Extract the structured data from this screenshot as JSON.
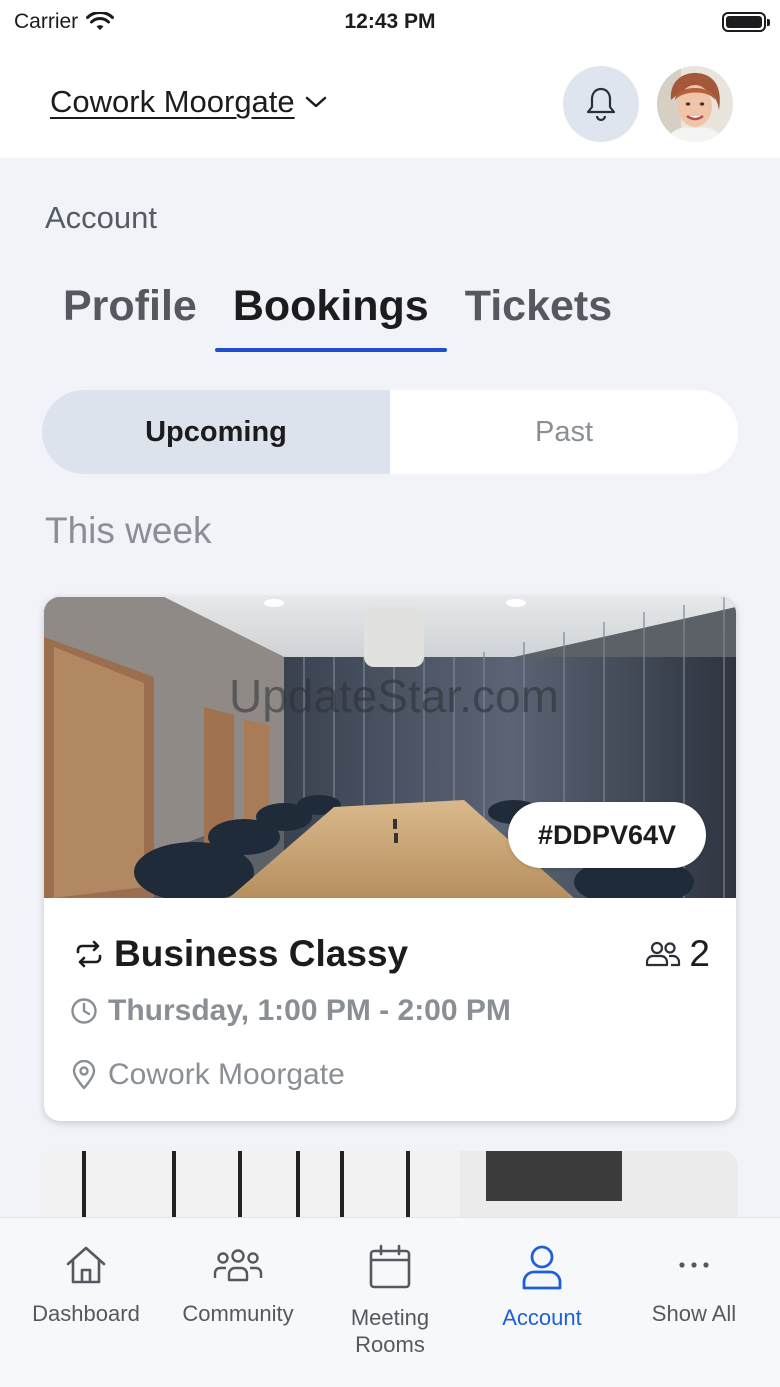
{
  "status_bar": {
    "carrier": "Carrier",
    "time": "12:43 PM"
  },
  "header": {
    "location": "Cowork Moorgate"
  },
  "account": {
    "title": "Account",
    "tabs": [
      {
        "label": "Profile",
        "active": false
      },
      {
        "label": "Bookings",
        "active": true
      },
      {
        "label": "Tickets",
        "active": false
      }
    ],
    "segments": {
      "upcoming": "Upcoming",
      "past": "Past"
    },
    "section_label": "This week"
  },
  "booking": {
    "code": "#DDPV64V",
    "room": "Business Classy",
    "capacity": "2",
    "time": "Thursday, 1:00 PM - 2:00 PM",
    "location": "Cowork Moorgate",
    "watermark": "UpdateStar.com"
  },
  "tabbar": {
    "items": [
      {
        "label": "Dashboard",
        "icon": "home-icon"
      },
      {
        "label": "Community",
        "icon": "community-icon"
      },
      {
        "label": "Meeting Rooms",
        "icon": "calendar-icon"
      },
      {
        "label": "Account",
        "icon": "user-icon"
      },
      {
        "label": "Show All",
        "icon": "more-icon"
      }
    ]
  },
  "colors": {
    "accent": "#1f4fcc",
    "active_tab": "#1f5fd8",
    "background": "#f1f3f8"
  }
}
